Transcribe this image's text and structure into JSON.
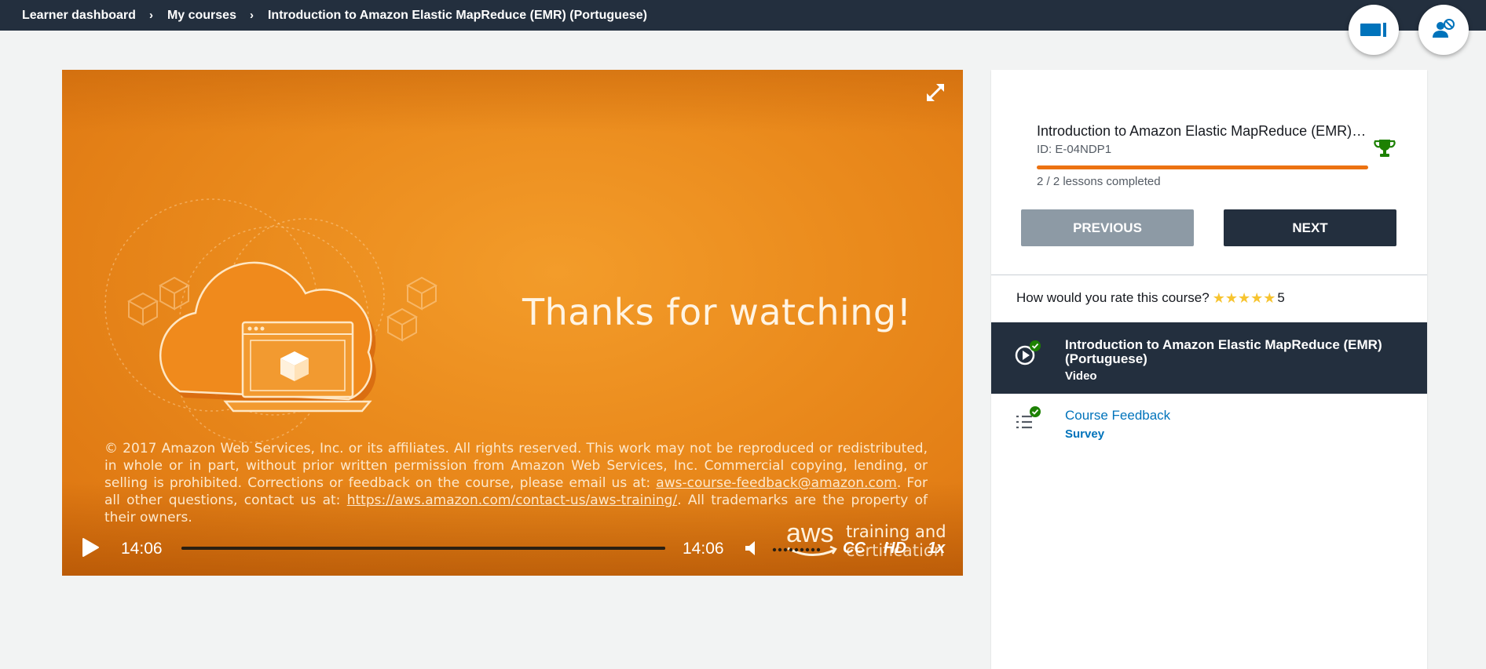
{
  "breadcrumb": {
    "items": [
      "Learner dashboard",
      "My courses",
      "Introduction to Amazon Elastic MapReduce (EMR) (Portuguese)"
    ],
    "separator": "›"
  },
  "header_actions": [
    {
      "icon": "presentation-icon",
      "color": "#0073bb"
    },
    {
      "icon": "user-block-icon",
      "color": "#0073bb"
    }
  ],
  "video": {
    "headline": "Thanks for watching!",
    "legal": {
      "part1": "© 2017 Amazon Web Services, Inc. or its affiliates. All rights reserved. This work may not be reproduced or redistributed, in whole or in part, without prior written permission from Amazon Web Services, Inc. Commercial copying, lending, or selling is prohibited. Corrections or feedback on the course, please email us at: ",
      "email": "aws-course-feedback@amazon.com",
      "part2": ". For all other questions, contact us at: ",
      "url": "https://aws.amazon.com/contact-us/aws-training/",
      "part3": ". All trademarks are the property of their owners."
    },
    "logo": {
      "brand": "aws",
      "line1": "training and",
      "line2": "certification"
    },
    "controls": {
      "current_time": "14:06",
      "duration": "14:06",
      "progress": 1.0,
      "cc_label": "CC",
      "hd_label": "HD",
      "speed_label": "1x"
    },
    "colors": {
      "background": "#ea8a1c"
    }
  },
  "course": {
    "title": "Introduction to Amazon Elastic MapReduce (EMR) (Portuguese)",
    "id": "ID: E-04NDP1",
    "progress": 1.0,
    "lessons_completed": "2 / 2 lessons completed",
    "prev_label": "PREVIOUS",
    "next_label": "NEXT",
    "accent": "#ec7211",
    "trophy_color": "#1d8102"
  },
  "rating": {
    "question": "How would you rate this course?",
    "stars": 5,
    "value": "5"
  },
  "lessons": [
    {
      "title": "Introduction to Amazon Elastic MapReduce (EMR) (Portuguese)",
      "type": "Video",
      "icon": "play-circle-icon",
      "completed": true
    },
    {
      "title": "Course Feedback",
      "type": "Survey",
      "icon": "list-icon",
      "completed": true
    }
  ]
}
